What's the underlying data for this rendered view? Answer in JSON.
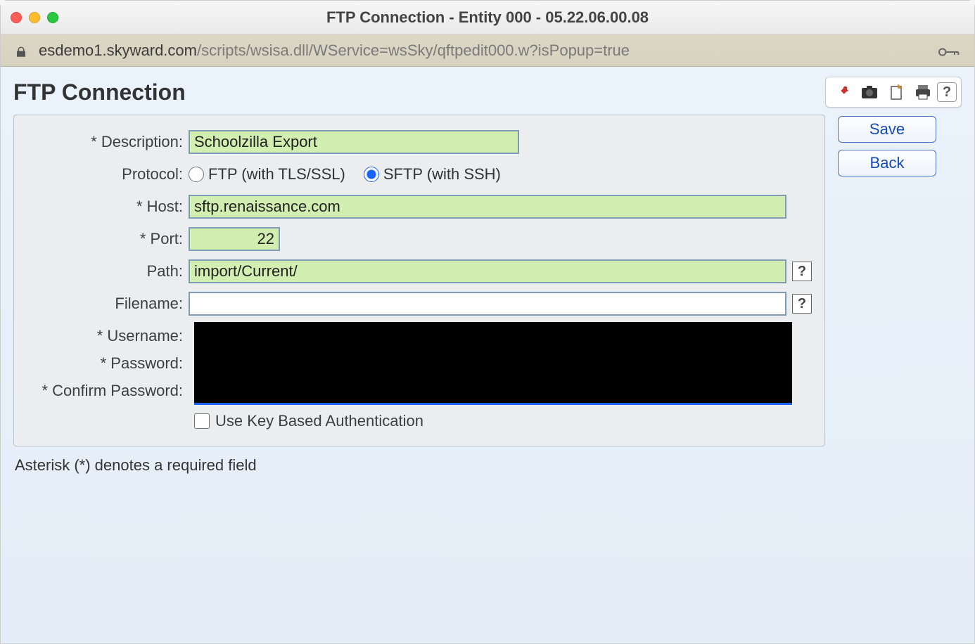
{
  "window": {
    "title": "FTP Connection - Entity 000 - 05.22.06.00.08"
  },
  "addressbar": {
    "domain": "esdemo1.skyward.com",
    "path": "/scripts/wsisa.dll/WService=wsSky/qftpedit000.w?isPopup=true"
  },
  "page": {
    "title": "FTP Connection",
    "footnote": "Asterisk (*) denotes a required field"
  },
  "toolbar": {
    "pin_title": "Pin",
    "camera_title": "Screenshot",
    "note_title": "Notes",
    "print_title": "Print",
    "help_title": "Help"
  },
  "side": {
    "save": "Save",
    "back": "Back"
  },
  "form": {
    "labels": {
      "description": "* Description:",
      "protocol": "Protocol:",
      "host": "* Host:",
      "port": "* Port:",
      "path": "Path:",
      "filename": "Filename:",
      "username": "* Username:",
      "password": "* Password:",
      "confirm": "* Confirm Password:"
    },
    "values": {
      "description": "Schoolzilla Export",
      "host": "sftp.renaissance.com",
      "port": "22",
      "path": "import/Current/",
      "filename": ""
    },
    "protocol": {
      "ftp_label": "FTP (with TLS/SSL)",
      "sftp_label": "SFTP (with SSH)",
      "selected": "sftp"
    },
    "keyauth_label": "Use Key Based Authentication",
    "keyauth_checked": false
  }
}
